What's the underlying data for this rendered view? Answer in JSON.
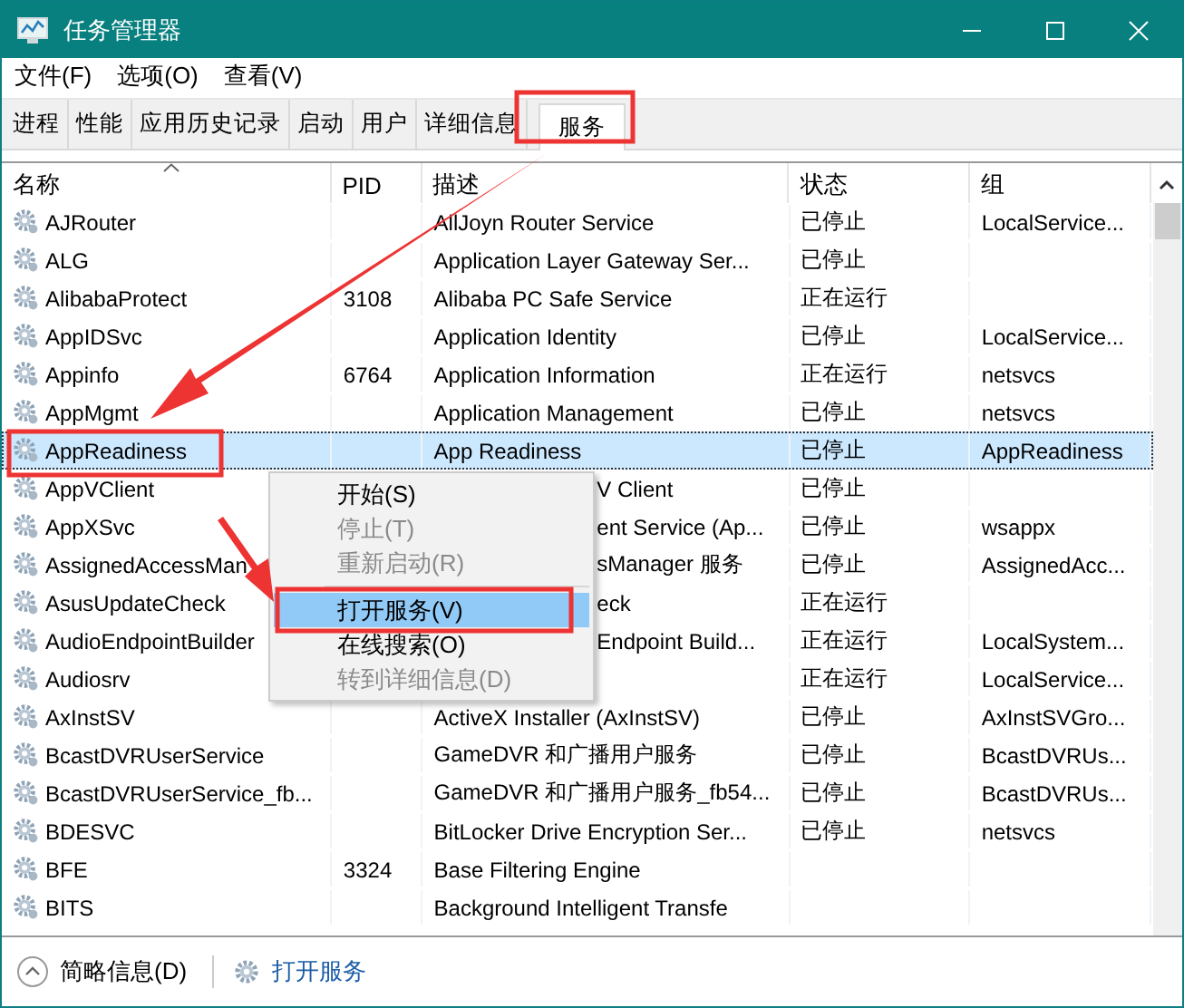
{
  "window": {
    "title": "任务管理器"
  },
  "menu_bar": [
    "文件(F)",
    "选项(O)",
    "查看(V)"
  ],
  "tabs": [
    {
      "label": "进程",
      "selected": false
    },
    {
      "label": "性能",
      "selected": false
    },
    {
      "label": "应用历史记录",
      "selected": false
    },
    {
      "label": "启动",
      "selected": false
    },
    {
      "label": "用户",
      "selected": false
    },
    {
      "label": "详细信息",
      "selected": false
    },
    {
      "label": "服务",
      "selected": true
    }
  ],
  "table": {
    "columns": [
      "名称",
      "PID",
      "描述",
      "状态",
      "组"
    ],
    "rows": [
      {
        "name": "AJRouter",
        "pid": "",
        "description": "AllJoyn Router Service",
        "status": "已停止",
        "group": "LocalService...",
        "selected": false
      },
      {
        "name": "ALG",
        "pid": "",
        "description": "Application Layer Gateway Ser...",
        "status": "已停止",
        "group": "",
        "selected": false
      },
      {
        "name": "AlibabaProtect",
        "pid": "3108",
        "description": "Alibaba PC Safe Service",
        "status": "正在运行",
        "group": "",
        "selected": false
      },
      {
        "name": "AppIDSvc",
        "pid": "",
        "description": "Application Identity",
        "status": "已停止",
        "group": "LocalService...",
        "selected": false
      },
      {
        "name": "Appinfo",
        "pid": "6764",
        "description": "Application Information",
        "status": "正在运行",
        "group": "netsvcs",
        "selected": false
      },
      {
        "name": "AppMgmt",
        "pid": "",
        "description": "Application Management",
        "status": "已停止",
        "group": "netsvcs",
        "selected": false
      },
      {
        "name": "AppReadiness",
        "pid": "",
        "description": "App Readiness",
        "status": "已停止",
        "group": "AppReadiness",
        "selected": true
      },
      {
        "name": "AppVClient",
        "pid": "",
        "description": "V Client",
        "description_clipped": true,
        "status": "已停止",
        "group": "",
        "selected": false
      },
      {
        "name": "AppXSvc",
        "pid": "",
        "description": "ent Service (Ap...",
        "description_clipped": true,
        "status": "已停止",
        "group": "wsappx",
        "selected": false
      },
      {
        "name": "AssignedAccessMan",
        "pid": "",
        "description": "sManager 服务",
        "description_clipped": true,
        "status": "已停止",
        "group": "AssignedAcc...",
        "selected": false
      },
      {
        "name": "AsusUpdateCheck",
        "pid": "",
        "description": "eck",
        "description_clipped": true,
        "status": "正在运行",
        "group": "",
        "selected": false
      },
      {
        "name": "AudioEndpointBuilder",
        "pid": "",
        "description": "Endpoint Build...",
        "description_clipped": true,
        "status": "正在运行",
        "group": "LocalSystem...",
        "selected": false
      },
      {
        "name": "Audiosrv",
        "pid": "",
        "description": "",
        "description_clipped": true,
        "status": "正在运行",
        "group": "LocalService...",
        "selected": false
      },
      {
        "name": "AxInstSV",
        "pid": "",
        "description": "ActiveX Installer (AxInstSV)",
        "status": "已停止",
        "group": "AxInstSVGro...",
        "selected": false
      },
      {
        "name": "BcastDVRUserService",
        "pid": "",
        "description": "GameDVR 和广播用户服务",
        "status": "已停止",
        "group": "BcastDVRUs...",
        "selected": false
      },
      {
        "name": "BcastDVRUserService_fb...",
        "pid": "",
        "description": "GameDVR 和广播用户服务_fb54...",
        "status": "已停止",
        "group": "BcastDVRUs...",
        "selected": false
      },
      {
        "name": "BDESVC",
        "pid": "",
        "description": "BitLocker Drive Encryption Ser...",
        "status": "已停止",
        "group": "netsvcs",
        "selected": false
      },
      {
        "name": "BFE",
        "pid": "3324",
        "description": "Base Filtering Engine",
        "status": "",
        "group": "",
        "selected": false
      },
      {
        "name": "BITS",
        "pid": "",
        "description": "Background Intelligent Transfe",
        "status": "",
        "group": "",
        "selected": false
      }
    ]
  },
  "context_menu": [
    {
      "kind": "item",
      "label": "开始(S)",
      "disabled": false,
      "selected": false
    },
    {
      "kind": "item",
      "label": "停止(T)",
      "disabled": true,
      "selected": false
    },
    {
      "kind": "item",
      "label": "重新启动(R)",
      "disabled": true,
      "selected": false
    },
    {
      "kind": "separator"
    },
    {
      "kind": "item",
      "label": "打开服务(V)",
      "disabled": false,
      "selected": true
    },
    {
      "kind": "item",
      "label": "在线搜索(O)",
      "disabled": false,
      "selected": false
    },
    {
      "kind": "item",
      "label": "转到详细信息(D)",
      "disabled": true,
      "selected": false
    }
  ],
  "status_bar": {
    "details_toggle": "简略信息(D)",
    "link": "打开服务"
  }
}
